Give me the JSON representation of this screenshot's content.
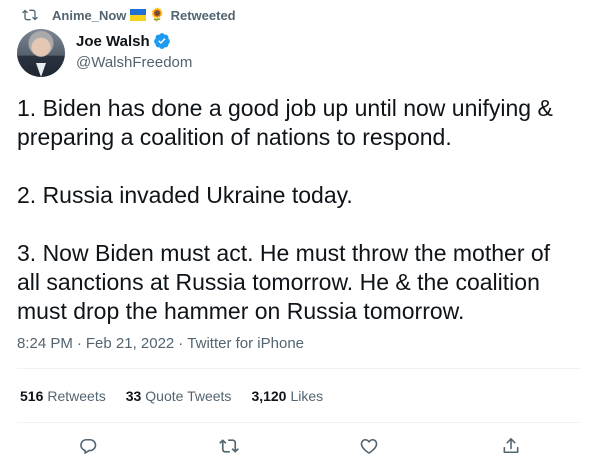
{
  "retweet_context": {
    "retweeter": "Anime_Now",
    "flag_emoji": "ukraine-flag-icon",
    "sunflower_emoji": "🌻",
    "label": "Retweeted"
  },
  "author": {
    "display_name": "Joe Walsh",
    "handle": "@WalshFreedom",
    "verified": true
  },
  "tweet": {
    "text": "1. Biden has done a good job up until now unifying &\npreparing a coalition of nations to respond.\n\n2. Russia invaded Ukraine today.\n\n3. Now Biden must act. He must throw the mother of\nall sanctions at Russia tomorrow. He & the coalition\nmust drop the hammer on Russia tomorrow."
  },
  "meta": {
    "time": "8:24 PM",
    "separator": "·",
    "date": "Feb 21, 2022",
    "source": "Twitter for iPhone"
  },
  "stats": {
    "retweets_count": "516",
    "retweets_label": "Retweets",
    "quotes_count": "33",
    "quotes_label": "Quote Tweets",
    "likes_count": "3,120",
    "likes_label": "Likes"
  },
  "colors": {
    "text_primary": "#0f1419",
    "text_secondary": "#536471",
    "verified_blue": "#1d9bf0",
    "divider": "#eff3f4"
  }
}
